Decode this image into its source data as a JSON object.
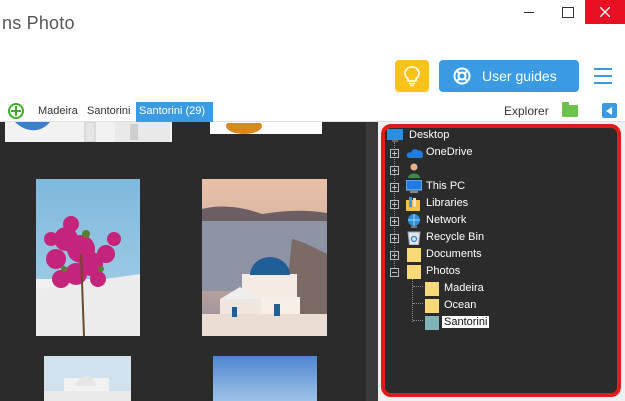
{
  "window": {
    "title": "ns Photo",
    "minimize_icon": "minimize-icon",
    "maximize_icon": "maximize-icon",
    "close_icon": "close-icon",
    "close_color": "#e81123"
  },
  "toolbar": {
    "tips_icon": "lightbulb-icon",
    "guides_icon": "lifebuoy-icon",
    "guides_label": "User guides",
    "menu_icon": "hamburger-icon",
    "accent": "#3a9be2",
    "tips_color": "#f8c21a"
  },
  "tabs": {
    "add_icon": "add-tab-icon",
    "items": [
      {
        "label": "Madeira",
        "active": false
      },
      {
        "label": "Santorini",
        "active": false
      },
      {
        "label": "Santorini (29)",
        "active": true
      }
    ],
    "explorer_label": "Explorer",
    "folder_icon": "folder-icon",
    "collapse_icon": "collapse-panel-icon"
  },
  "tree": {
    "highlight_color": "#e01c1c",
    "items": [
      {
        "label": "Desktop",
        "icon": "desktop-icon",
        "level": 0
      },
      {
        "label": "OneDrive",
        "icon": "onedrive-cloud-icon",
        "level": 1
      },
      {
        "label": "",
        "icon": "user-icon",
        "level": 1
      },
      {
        "label": "This PC",
        "icon": "computer-icon",
        "level": 1
      },
      {
        "label": "Libraries",
        "icon": "libraries-icon",
        "level": 1
      },
      {
        "label": "Network",
        "icon": "network-icon",
        "level": 1
      },
      {
        "label": "Recycle Bin",
        "icon": "recycle-bin-icon",
        "level": 1
      },
      {
        "label": "Documents",
        "icon": "folder-icon",
        "level": 1
      },
      {
        "label": "Photos",
        "icon": "folder-open-icon",
        "level": 1
      },
      {
        "label": "Madeira",
        "icon": "folder-icon",
        "level": 2
      },
      {
        "label": "Ocean",
        "icon": "folder-icon",
        "level": 2
      },
      {
        "label": "Santorini",
        "icon": "folder-selected-icon",
        "level": 2,
        "selected": true
      }
    ]
  }
}
